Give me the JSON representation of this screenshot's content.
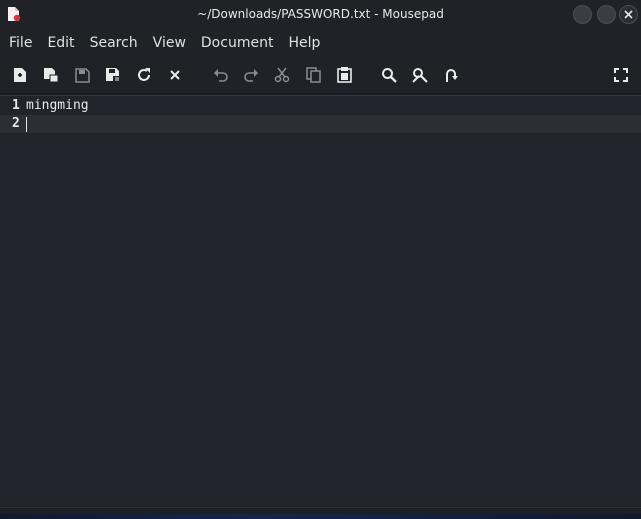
{
  "window": {
    "title": "~/Downloads/PASSWORD.txt - Mousepad"
  },
  "menubar": {
    "items": [
      "File",
      "Edit",
      "Search",
      "View",
      "Document",
      "Help"
    ]
  },
  "toolbar": {
    "icons": [
      "new-document-icon",
      "new-window-icon",
      "save-icon",
      "save-as-icon",
      "reload-icon",
      "close-document-icon",
      "undo-icon",
      "redo-icon",
      "cut-icon",
      "copy-icon",
      "paste-icon",
      "find-icon",
      "find-replace-icon",
      "go-to-line-icon",
      "fullscreen-icon"
    ]
  },
  "editor": {
    "lines": [
      {
        "number": "1",
        "text": "mingming"
      },
      {
        "number": "2",
        "text": ""
      }
    ],
    "current_line": 2
  },
  "colors": {
    "background": "#22242c",
    "chrome": "#202228",
    "current_line": "#2c2e34",
    "accent_red": "#d9333a"
  }
}
